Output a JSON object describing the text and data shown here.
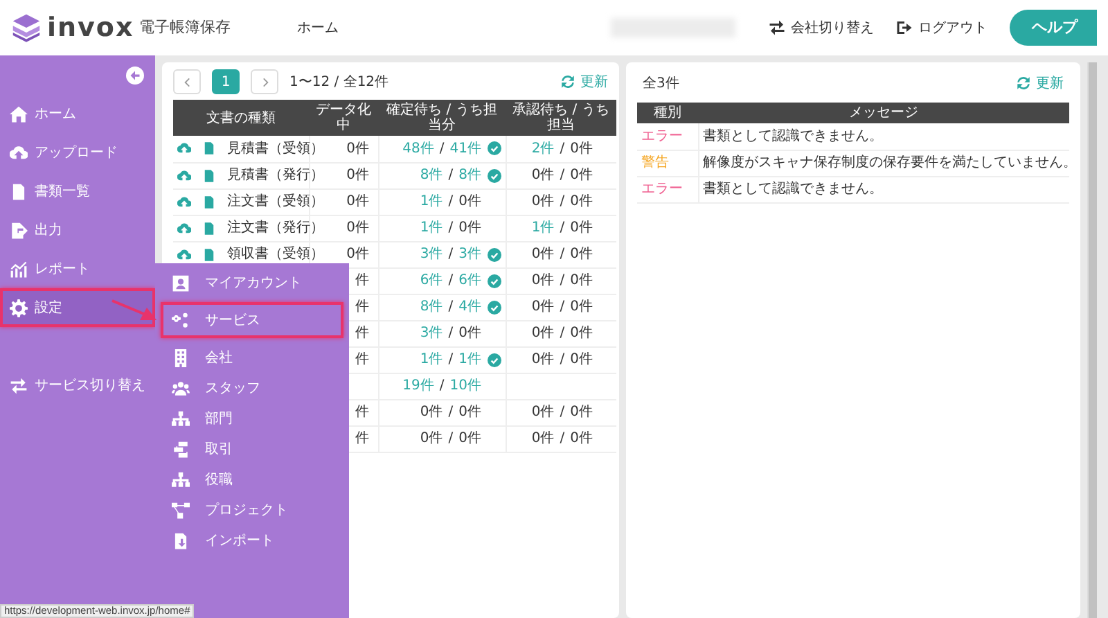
{
  "header": {
    "logo_text": "invox",
    "logo_subtitle": "電子帳簿保存",
    "nav": [
      "ホーム"
    ],
    "actions": [
      "会社切り替え",
      "ログアウト"
    ],
    "help_button": "ヘルプ"
  },
  "sidebar": {
    "items": [
      {
        "label": "ホーム",
        "selected": false,
        "annotated": false
      },
      {
        "label": "アップロード",
        "selected": false,
        "annotated": false
      },
      {
        "label": "書類一覧",
        "selected": false,
        "annotated": false
      },
      {
        "label": "出力",
        "selected": false,
        "annotated": false
      },
      {
        "label": "レポート",
        "selected": false,
        "annotated": false
      },
      {
        "label": "設定",
        "selected": true,
        "annotated": true
      }
    ],
    "bottom_items": [
      {
        "label": "サービス切り替え",
        "selected": false,
        "annotated": false
      }
    ]
  },
  "submenu": {
    "items": [
      {
        "label": "マイアカウント",
        "annotated": false
      },
      {
        "label": "サービス",
        "annotated": true
      },
      {
        "label": "会社",
        "annotated": false
      },
      {
        "label": "スタッフ",
        "annotated": false
      },
      {
        "label": "部門",
        "annotated": false
      },
      {
        "label": "取引",
        "annotated": false
      },
      {
        "label": "役職",
        "annotated": false
      },
      {
        "label": "プロジェクト",
        "annotated": false
      },
      {
        "label": "インポート",
        "annotated": false
      }
    ]
  },
  "documents_panel": {
    "pages": [
      {
        "label": "1",
        "selected": true
      }
    ],
    "summary": "1〜12 / 全12件",
    "refresh": "更新",
    "separator": "/",
    "columns": [
      "文書の種類",
      "データ化中",
      "確定待ち / うち担当分",
      "承認待ち / うち担当"
    ],
    "rows": [
      {
        "document": "見積書（受領）",
        "processing": "0件",
        "confirm": {
          "total": "48件",
          "mine": "41件",
          "total_link": true,
          "mine_link": true,
          "complete": true
        },
        "approve": {
          "total": "2件",
          "mine": "0件",
          "total_link": true,
          "mine_link": false,
          "complete": false
        }
      },
      {
        "document": "見積書（発行）",
        "processing": "0件",
        "confirm": {
          "total": "8件",
          "mine": "8件",
          "total_link": true,
          "mine_link": true,
          "complete": true
        },
        "approve": {
          "total": "0件",
          "mine": "0件",
          "total_link": false,
          "mine_link": false,
          "complete": false
        }
      },
      {
        "document": "注文書（受領）",
        "processing": "0件",
        "confirm": {
          "total": "1件",
          "mine": "0件",
          "total_link": true,
          "mine_link": false,
          "complete": false
        },
        "approve": {
          "total": "0件",
          "mine": "0件",
          "total_link": false,
          "mine_link": false,
          "complete": false
        }
      },
      {
        "document": "注文書（発行）",
        "processing": "0件",
        "confirm": {
          "total": "1件",
          "mine": "0件",
          "total_link": true,
          "mine_link": false,
          "complete": false
        },
        "approve": {
          "total": "1件",
          "mine": "0件",
          "total_link": true,
          "mine_link": false,
          "complete": false
        }
      },
      {
        "document": "領収書（受領）",
        "processing": "0件",
        "confirm": {
          "total": "3件",
          "mine": "3件",
          "total_link": true,
          "mine_link": true,
          "complete": true
        },
        "approve": {
          "total": "0件",
          "mine": "0件",
          "total_link": false,
          "mine_link": false,
          "complete": false
        }
      },
      {
        "processing": "件",
        "confirm": {
          "total": "6件",
          "mine": "6件",
          "total_link": true,
          "mine_link": true,
          "complete": true
        },
        "approve": {
          "total": "0件",
          "mine": "0件",
          "total_link": false,
          "mine_link": false,
          "complete": false
        }
      },
      {
        "processing": "件",
        "confirm": {
          "total": "8件",
          "mine": "4件",
          "total_link": true,
          "mine_link": true,
          "complete": true
        },
        "approve": {
          "total": "0件",
          "mine": "0件",
          "total_link": false,
          "mine_link": false,
          "complete": false
        }
      },
      {
        "processing": "件",
        "confirm": {
          "total": "3件",
          "mine": "0件",
          "total_link": true,
          "mine_link": false,
          "complete": false
        },
        "approve": {
          "total": "0件",
          "mine": "0件",
          "total_link": false,
          "mine_link": false,
          "complete": false
        }
      },
      {
        "processing": "件",
        "confirm": {
          "total": "1件",
          "mine": "1件",
          "total_link": true,
          "mine_link": true,
          "complete": true
        },
        "approve": {
          "total": "0件",
          "mine": "0件",
          "total_link": false,
          "mine_link": false,
          "complete": false
        }
      },
      {
        "confirm": {
          "total": "19件",
          "mine": "10件",
          "total_link": true,
          "mine_link": true,
          "complete": false
        }
      },
      {
        "processing": "件",
        "confirm": {
          "total": "0件",
          "mine": "0件",
          "total_link": false,
          "mine_link": false,
          "complete": false
        },
        "approve": {
          "total": "0件",
          "mine": "0件",
          "total_link": false,
          "mine_link": false,
          "complete": false
        }
      },
      {
        "processing": "件",
        "confirm": {
          "total": "0件",
          "mine": "0件",
          "total_link": false,
          "mine_link": false,
          "complete": false
        },
        "approve": {
          "total": "0件",
          "mine": "0件",
          "total_link": false,
          "mine_link": false,
          "complete": false
        }
      }
    ]
  },
  "messages_panel": {
    "count": "全3件",
    "refresh": "更新",
    "columns": [
      "種別",
      "メッセージ"
    ],
    "rows": [
      {
        "type": "エラー",
        "color": "#f06292",
        "message": "書類として認識できません。"
      },
      {
        "type": "警告",
        "color": "#f5a623",
        "message": "解像度がスキャナ保存制度の保存要件を満たしていません。"
      },
      {
        "type": "エラー",
        "color": "#f06292",
        "message": "書類として認識できません。"
      }
    ]
  },
  "status_url": "https://development-web.invox.jp/home#"
}
